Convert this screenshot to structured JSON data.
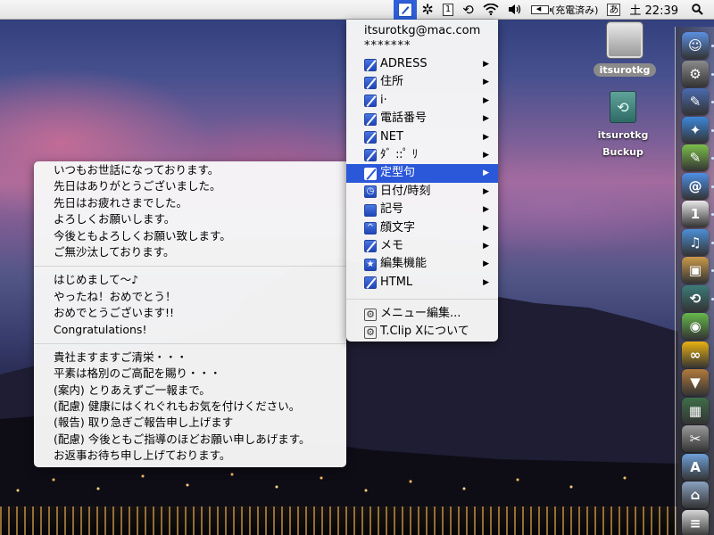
{
  "menubar": {
    "tclip_icon": "tclip-icon",
    "items": [
      {
        "name": "gear-icon",
        "glyph": "✲"
      },
      {
        "name": "calendar-icon",
        "glyph": "1"
      },
      {
        "name": "time-machine-icon",
        "glyph": "⟲"
      },
      {
        "name": "wifi-icon",
        "glyph": "〰"
      },
      {
        "name": "volume-icon",
        "glyph": "🔊"
      }
    ],
    "battery": "(充電済み)",
    "ime": "あ",
    "clock": "土 22:39",
    "spotlight_icon": "search-icon"
  },
  "main_menu": {
    "account": "itsurotkg@mac.com",
    "password": "*******",
    "items": [
      {
        "label": "ADRESS",
        "icon": "pencil-icon",
        "submenu": true
      },
      {
        "label": "住所",
        "icon": "pencil-icon",
        "submenu": true
      },
      {
        "label": "i·",
        "icon": "pencil-icon",
        "submenu": true
      },
      {
        "label": "電話番号",
        "icon": "pencil-icon",
        "submenu": true
      },
      {
        "label": "NET",
        "icon": "pencil-icon",
        "submenu": true
      },
      {
        "label": "ﾀﾞ ::ﾟ ﾘ",
        "icon": "pencil-icon",
        "submenu": true
      },
      {
        "label": "定型句",
        "icon": "pencil-icon",
        "submenu": true,
        "selected": true
      },
      {
        "label": "日付/時刻",
        "icon": "clock-icon",
        "submenu": true
      },
      {
        "label": "記号",
        "icon": "apple-icon",
        "submenu": true
      },
      {
        "label": "顔文字",
        "icon": "face-icon",
        "submenu": true
      },
      {
        "label": "メモ",
        "icon": "pencil-icon",
        "submenu": true
      },
      {
        "label": "編集機能",
        "icon": "star-icon",
        "submenu": true
      },
      {
        "label": "HTML",
        "icon": "pencil-icon",
        "submenu": true
      }
    ],
    "footer_items": [
      {
        "label": "メニュー編集...",
        "icon": "gear-icon"
      },
      {
        "label": "T.Clip Xについて",
        "icon": "gear-icon"
      }
    ]
  },
  "sub_menu": {
    "groups": [
      [
        "いつもお世話になっております。",
        "先日はありがとうございました。",
        "先日はお疲れさまでした。",
        "よろしくお願いします。",
        "今後ともよろしくお願い致します。",
        "ご無沙汰しております。"
      ],
      [
        "はじめまして〜♪",
        "やったね！おめでとう！",
        "おめでとうございます!!",
        "Congratulations!"
      ],
      [
        "貴社ますますご清栄・・・",
        "平素は格別のご高配を賜り・・・",
        "(案内) とりあえずご一報まで。",
        "(配慮) 健康にはくれぐれもお気を付けください。",
        "(報告) 取り急ぎご報告申し上げます",
        "(配慮) 今後ともご指導のほどお願い申しあげます。",
        "お返事お待ち申し上げております。"
      ]
    ]
  },
  "desktop_icons": [
    {
      "label": "itsurotkg",
      "name": "hard-drive-icon"
    },
    {
      "label_line1": "itsurotkg",
      "label_line2": "Buckup",
      "name": "backup-drive-icon"
    }
  ],
  "dock": {
    "items": [
      {
        "name": "finder-icon",
        "glyph": "☺",
        "color": "#5b8fe0"
      },
      {
        "name": "system-preferences-icon",
        "glyph": "⚙",
        "color": "#8a8a8a"
      },
      {
        "name": "xcode-icon",
        "glyph": "✎",
        "color": "#4a6bb0"
      },
      {
        "name": "safari-icon",
        "glyph": "✦",
        "color": "#3d86d9"
      },
      {
        "name": "textedit-icon",
        "glyph": "✎",
        "color": "#7bbf4a"
      },
      {
        "name": "mail-icon",
        "glyph": "@",
        "color": "#4d8fe6"
      },
      {
        "name": "ical-icon",
        "glyph": "1",
        "color": "#e8e8e8"
      },
      {
        "name": "itunes-icon",
        "glyph": "♫",
        "color": "#4c8fd6"
      },
      {
        "name": "iphoto-icon",
        "glyph": "▣",
        "color": "#c99a4a"
      },
      {
        "name": "time-machine-icon",
        "glyph": "⟲",
        "color": "#3b7b78"
      },
      {
        "name": "chat-icon",
        "glyph": "◉",
        "color": "#67b84b"
      },
      {
        "name": "app-infinity-icon",
        "glyph": "∞",
        "color": "#e8b012"
      },
      {
        "name": "bucket-icon",
        "glyph": "▼",
        "color": "#b07a3c"
      },
      {
        "name": "photo-viewer-icon",
        "glyph": "▦",
        "color": "#3e6e48"
      },
      {
        "name": "script-icon",
        "glyph": "✂",
        "color": "#9a9a9a"
      },
      {
        "name": "applications-folder-icon",
        "glyph": "A",
        "color": "#6fa0d8"
      },
      {
        "name": "home-folder-icon",
        "glyph": "⌂",
        "color": "#8aa2c0"
      },
      {
        "name": "document-icon",
        "glyph": "≡",
        "color": "#d6d6d6"
      }
    ]
  }
}
